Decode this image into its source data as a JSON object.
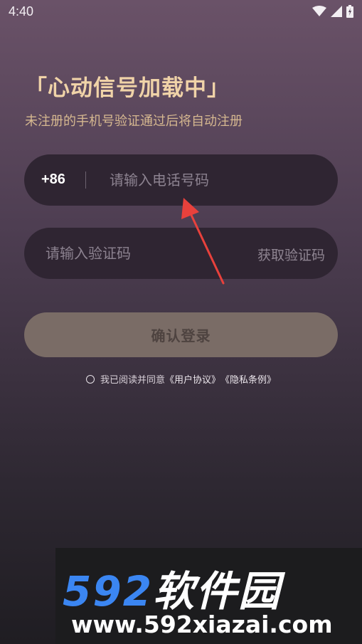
{
  "status_bar": {
    "time": "4:40",
    "icons": [
      "wifi-icon",
      "signal-icon",
      "battery-icon"
    ]
  },
  "header": {
    "title": "「心动信号加载中」",
    "subtitle": "未注册的手机号验证通过后将自动注册"
  },
  "phone": {
    "country_code": "+86",
    "placeholder": "请输入电话号码",
    "value": ""
  },
  "code": {
    "placeholder": "请输入验证码",
    "value": "",
    "get_code_label": "获取验证码"
  },
  "confirm": {
    "label": "确认登录"
  },
  "agreement": {
    "prefix": "我已阅读并同意",
    "user_agreement": "《用户协议》",
    "privacy": "《隐私条例》",
    "checked": false
  },
  "watermark": {
    "logo_number": "592",
    "logo_text": "软件园",
    "url": "www.592xiazai.com"
  },
  "colors": {
    "title": "#f0d3a8",
    "subtitle": "#d6b890",
    "input_bg": "#2f2532",
    "button_bg": "#7a6c66",
    "arrow": "#e8413c",
    "watermark_blue": "#3b86f2"
  }
}
